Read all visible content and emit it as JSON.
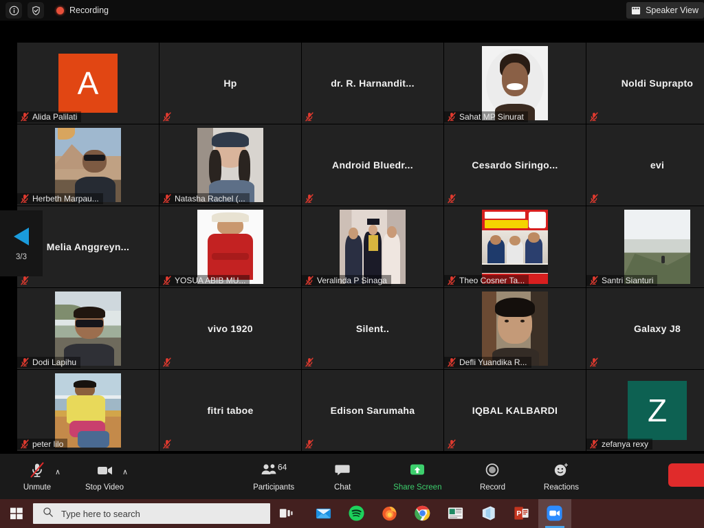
{
  "topbar": {
    "info_icon": "info-icon",
    "shield_icon": "shield-icon",
    "recording_label": "Recording",
    "recording_dot_color": "#e8503a",
    "speaker_view_label": "Speaker View",
    "speaker_view_icon": "view-layout-icon"
  },
  "page_nav": {
    "prev_icon": "chevron-left-icon",
    "arrow_color": "#1a9bdc",
    "page_indicator": "3/3"
  },
  "gallery": {
    "columns": 5,
    "rows": 5,
    "tiles": [
      {
        "name": "Alida Palilati",
        "display": "avatar",
        "letter": "A",
        "avatar_color": "#e14613",
        "label_position": "bottom",
        "muted": true
      },
      {
        "name": "Hp",
        "display": "name",
        "label_position": "center",
        "muted": true
      },
      {
        "name": "dr. R. Harnandit...",
        "display": "name",
        "label_position": "center",
        "muted": true
      },
      {
        "name": "Sahat MP Sinurat",
        "display": "photo",
        "photo": "portrait-man-smiling",
        "label_position": "bottom",
        "muted": true
      },
      {
        "name": "Noldi Suprapto",
        "display": "name",
        "label_position": "center",
        "muted": true
      },
      {
        "name": "Herbeth Marpau...",
        "display": "photo",
        "photo": "man-sunglasses-mountain",
        "label_position": "bottom",
        "muted": true
      },
      {
        "name": "Natasha Rachel (...",
        "display": "photo",
        "photo": "woman-beanie-indoor",
        "label_position": "bottom",
        "muted": true
      },
      {
        "name": "Android  Bluedr...",
        "display": "name",
        "label_position": "center",
        "muted": true
      },
      {
        "name": "Cesardo  Siringo...",
        "display": "name",
        "label_position": "center",
        "muted": true
      },
      {
        "name": "evi",
        "display": "name",
        "label_position": "center",
        "muted": true
      },
      {
        "name": "Melia  Anggreyn...",
        "display": "name",
        "label_position": "center",
        "muted": true
      },
      {
        "name": "YOSUA ABIB MU...",
        "display": "photo",
        "photo": "man-red-shirt-hat",
        "label_position": "bottom",
        "muted": true
      },
      {
        "name": "Veralinda P Sinaga",
        "display": "photo",
        "photo": "graduation-group",
        "label_position": "bottom",
        "muted": true
      },
      {
        "name": "Theo Cosner Ta...",
        "display": "photo",
        "photo": "campaign-poster",
        "label_position": "bottom",
        "muted": true
      },
      {
        "name": "Santri Sianturi",
        "display": "photo",
        "photo": "mountain-hillside",
        "label_position": "bottom",
        "muted": true
      },
      {
        "name": "Dodi Lapihu",
        "display": "photo",
        "photo": "man-sunglasses-beach",
        "label_position": "bottom",
        "muted": true
      },
      {
        "name": "vivo 1920",
        "display": "name",
        "label_position": "center",
        "muted": true
      },
      {
        "name": "Silent..",
        "display": "name",
        "label_position": "center",
        "muted": true
      },
      {
        "name": "Defli Yuandika R...",
        "display": "photo",
        "photo": "young-man-indoor",
        "label_position": "bottom",
        "muted": true
      },
      {
        "name": "Galaxy J8",
        "display": "name",
        "label_position": "center",
        "muted": true
      },
      {
        "name": "peter lilo",
        "display": "photo",
        "photo": "man-yellow-shirt-boat",
        "label_position": "bottom",
        "muted": true
      },
      {
        "name": "fitri taboe",
        "display": "name",
        "label_position": "center",
        "muted": true
      },
      {
        "name": "Edison Sarumaha",
        "display": "name",
        "label_position": "center",
        "muted": true
      },
      {
        "name": "IQBAL KALBARDI",
        "display": "name",
        "label_position": "center",
        "muted": true
      },
      {
        "name": "zefanya rexy",
        "display": "avatar",
        "letter": "Z",
        "avatar_color": "#0d6152",
        "label_position": "bottom",
        "muted": true
      }
    ]
  },
  "toolbar": {
    "mute_label": "Unmute",
    "mute_icon": "microphone-muted-icon",
    "video_label": "Stop Video",
    "video_icon": "video-camera-icon",
    "participants_label": "Participants",
    "participants_icon": "people-icon",
    "participants_count": "64",
    "chat_label": "Chat",
    "chat_icon": "chat-bubble-icon",
    "share_label": "Share Screen",
    "share_icon": "share-screen-icon",
    "share_color": "#3dcf6d",
    "record_label": "Record",
    "record_icon": "record-circle-icon",
    "reactions_label": "Reactions",
    "reactions_icon": "smiley-reaction-icon",
    "end_label": "",
    "end_color": "#e02b2b",
    "caret_glyph": "∧"
  },
  "taskbar": {
    "start_icon": "windows-start-icon",
    "search_placeholder": "Type here to search",
    "search_icon": "search-icon",
    "taskview_icon": "task-view-icon",
    "background_color": "#43201f",
    "apps": [
      {
        "icon": "mail-icon",
        "name": "Mail",
        "active": false
      },
      {
        "icon": "spotify-icon",
        "name": "Spotify",
        "active": false
      },
      {
        "icon": "firefox-icon",
        "name": "Firefox",
        "active": false
      },
      {
        "icon": "chrome-icon",
        "name": "Chrome",
        "active": false
      },
      {
        "icon": "news-icon",
        "name": "News",
        "active": false
      },
      {
        "icon": "office-icon",
        "name": "Office",
        "active": false
      },
      {
        "icon": "powerpoint-icon",
        "name": "PowerPoint",
        "active": false
      },
      {
        "icon": "zoom-icon",
        "name": "Zoom",
        "active": true
      }
    ]
  }
}
